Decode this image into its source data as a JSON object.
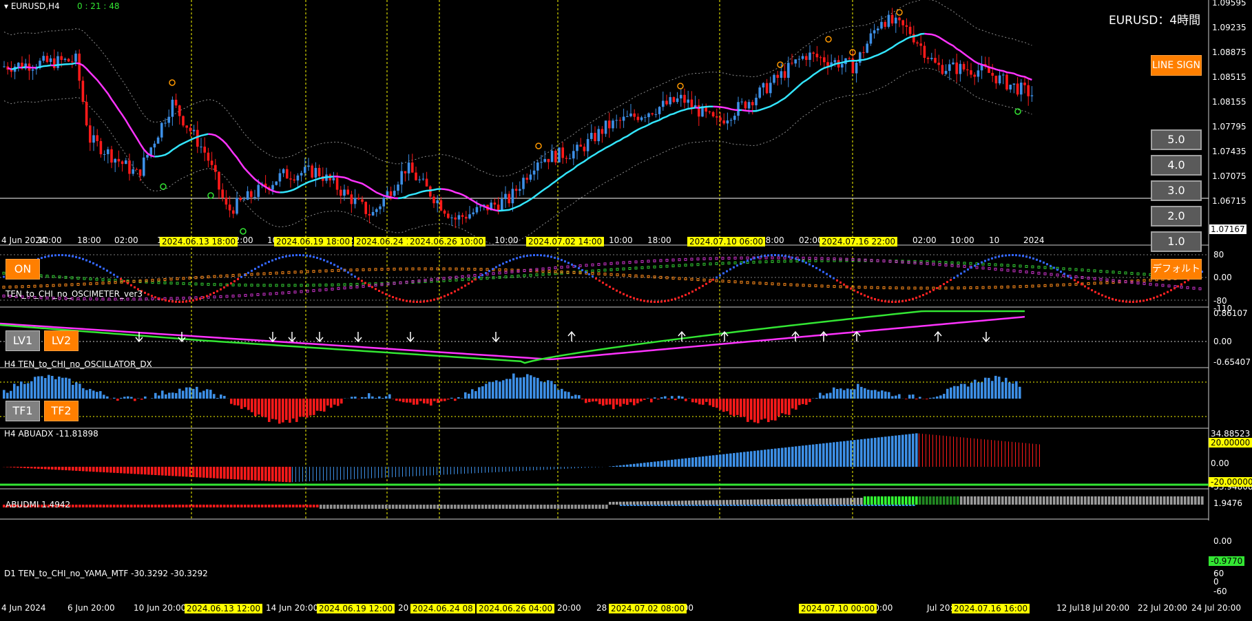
{
  "main": {
    "symbol": "EURUSD,H4",
    "timer": "0 : 21 : 48",
    "watermark": "EURUSD：4時間",
    "current_price": "1.07167",
    "price_ticks": [
      "1.09595",
      "1.09235",
      "1.08875",
      "1.08515",
      "1.08155",
      "1.07795",
      "1.07435",
      "1.07075",
      "1.06715"
    ],
    "time_ticks": [
      "4 Jun 2024",
      "10:00",
      "18:00",
      "02:00",
      "10",
      "02:00",
      "10",
      "02:",
      "0",
      "10:00",
      "10:00",
      "18:00",
      "18:00",
      "02:00",
      "2:00",
      "02:00",
      "10:00",
      "10",
      "2024"
    ],
    "date_badges": [
      "2024.06.13 18:00",
      "2024.06.19 18:00",
      "2024.06.24 14:",
      "2024.06.26 10:00",
      "2024.07.02 14:00",
      "2024.07.10 06:00",
      "2024.07.16 22:00"
    ]
  },
  "buttons": {
    "on": "ON",
    "line_sign": "LINE SIGN",
    "default": "デフォルト",
    "lv1": "LV1",
    "lv2": "LV2",
    "tf1": "TF1",
    "tf2": "TF2",
    "levels": [
      "5.0",
      "4.0",
      "3.0",
      "2.0",
      "1.0"
    ]
  },
  "osc1": {
    "title": "TEN_to_CHI_no_OSCIMETER_ver3",
    "ticks": [
      "80",
      "0.00",
      "-80",
      "-110"
    ]
  },
  "osc2": {
    "title": "H4  TEN_to_CHI_no_OSCILLATOR_DX",
    "ticks": [
      "0.86107",
      "0.00",
      "-0.65407"
    ]
  },
  "abuadx": {
    "title": "H4  ABUADX  -11.81898",
    "ticks": [
      "34.88523",
      "0.00",
      "-33.94808"
    ],
    "badge_top": "20.00000",
    "badge_bottom": "-20.00000"
  },
  "abudmi": {
    "title": "ABUDMI  1.4942",
    "ticks": [
      "1.9476",
      "0.00"
    ],
    "badge": "-0.9770"
  },
  "yama": {
    "title": "D1  TEN_to_CHI_no_YAMA_MTF  -30.3292  -30.3292",
    "ticks": [
      "60",
      "0",
      "-60"
    ]
  },
  "bottom_axis": {
    "ticks": [
      "4 Jun 2024",
      "6 Jun 20:00",
      "10 Jun 20:00",
      "14 Jun 20:00",
      "20",
      "un 20:00",
      "28",
      "0:00",
      "4 Jul 20:00",
      "Jul 20:00",
      "12 Jul",
      "18 Jul 20:00",
      "22 Jul 20:00",
      "24 Jul 20:00"
    ],
    "badges": [
      "2024.06.13 12:00",
      "2024.06.19 12:00",
      "2024.06.24 08",
      "2024.06.26 04:00",
      "2024.07.02 08:00",
      "2024.07.10 00:00",
      "2024.07.16 16:00"
    ]
  },
  "colors": {
    "bull": "#3d8fe6",
    "bear": "#ff1a1a",
    "ma": "#ff33ff",
    "ema": "#33e6ff",
    "green": "#33e633",
    "badge": "#ffff00",
    "orange": "#ff7f00"
  }
}
